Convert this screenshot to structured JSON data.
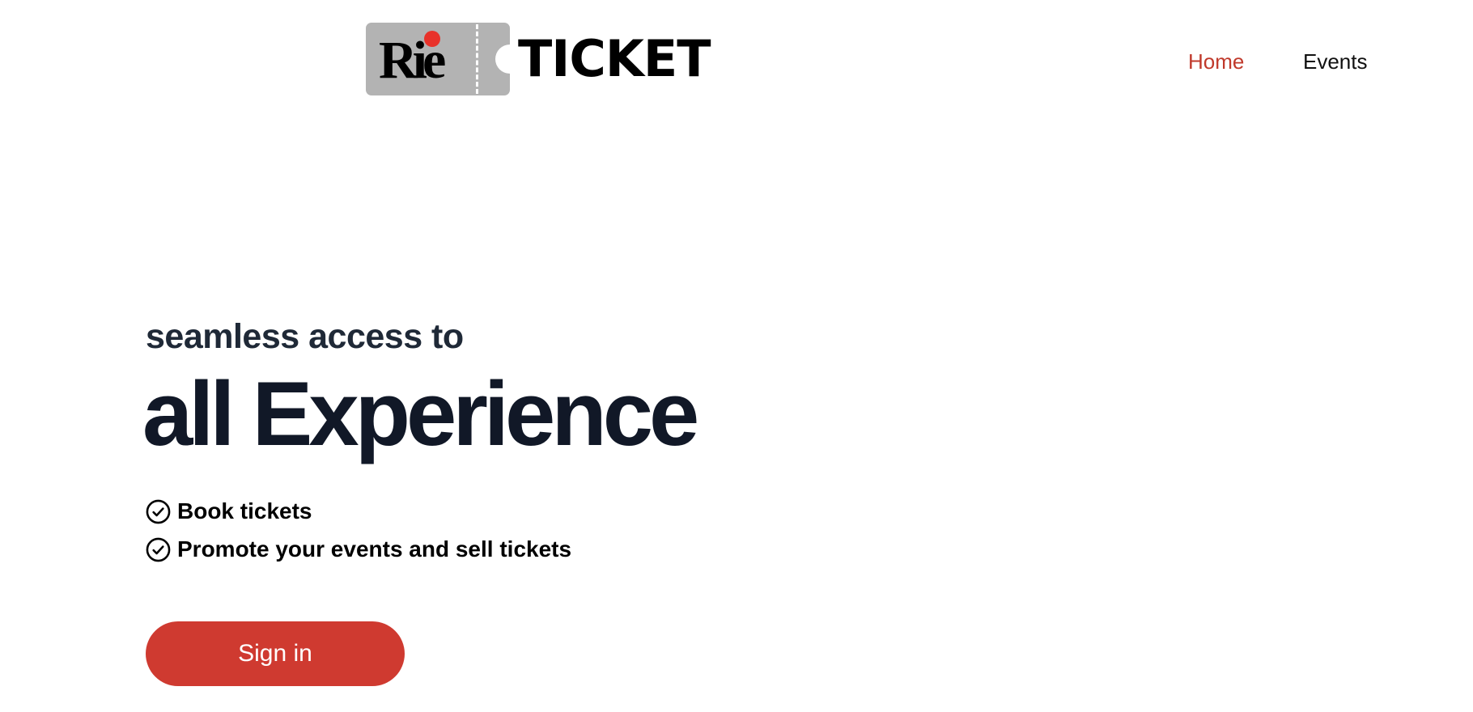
{
  "brand": {
    "logo_text_left": "Rie",
    "logo_text_right": "TICKET",
    "accent": "#cf3a30"
  },
  "nav": {
    "items": [
      {
        "label": "Home",
        "active": true
      },
      {
        "label": "Events",
        "active": false
      }
    ]
  },
  "hero": {
    "subtitle": "seamless access to",
    "headline": "all Experience",
    "features": [
      {
        "icon": "check-circle-icon",
        "label": "Book tickets"
      },
      {
        "icon": "check-circle-icon",
        "label": "Promote your events and sell tickets"
      }
    ],
    "cta_label": "Sign in"
  }
}
